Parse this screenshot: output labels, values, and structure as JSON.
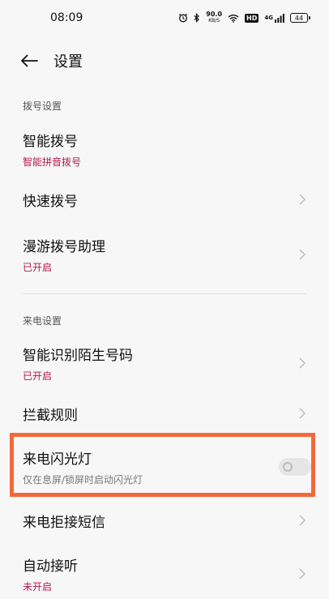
{
  "status": {
    "time": "08:09",
    "net_speed_value": "90.0",
    "net_speed_unit": "KB/S",
    "hd": "HD",
    "signal_label": "4G",
    "battery": "44"
  },
  "header": {
    "title": "设置"
  },
  "sections": [
    {
      "label": "拨号设置",
      "items": [
        {
          "title": "智能拨号",
          "subtitle": "智能拼音拨号"
        },
        {
          "title": "快速拨号"
        },
        {
          "title": "漫游拨号助理",
          "subtitle": "已开启"
        }
      ]
    },
    {
      "label": "来电设置",
      "items": [
        {
          "title": "智能识别陌生号码",
          "subtitle": "已开启"
        },
        {
          "title": "拦截规则"
        },
        {
          "title": "来电闪光灯",
          "subtitle": "仅在息屏/锁屏时启动闪光灯",
          "toggle": false
        },
        {
          "title": "来电拒接短信"
        },
        {
          "title": "自动接听",
          "subtitle": "未开启"
        }
      ]
    }
  ],
  "colors": {
    "accent_subtitle": "#b5174d",
    "highlight_border": "#f26a3a"
  }
}
